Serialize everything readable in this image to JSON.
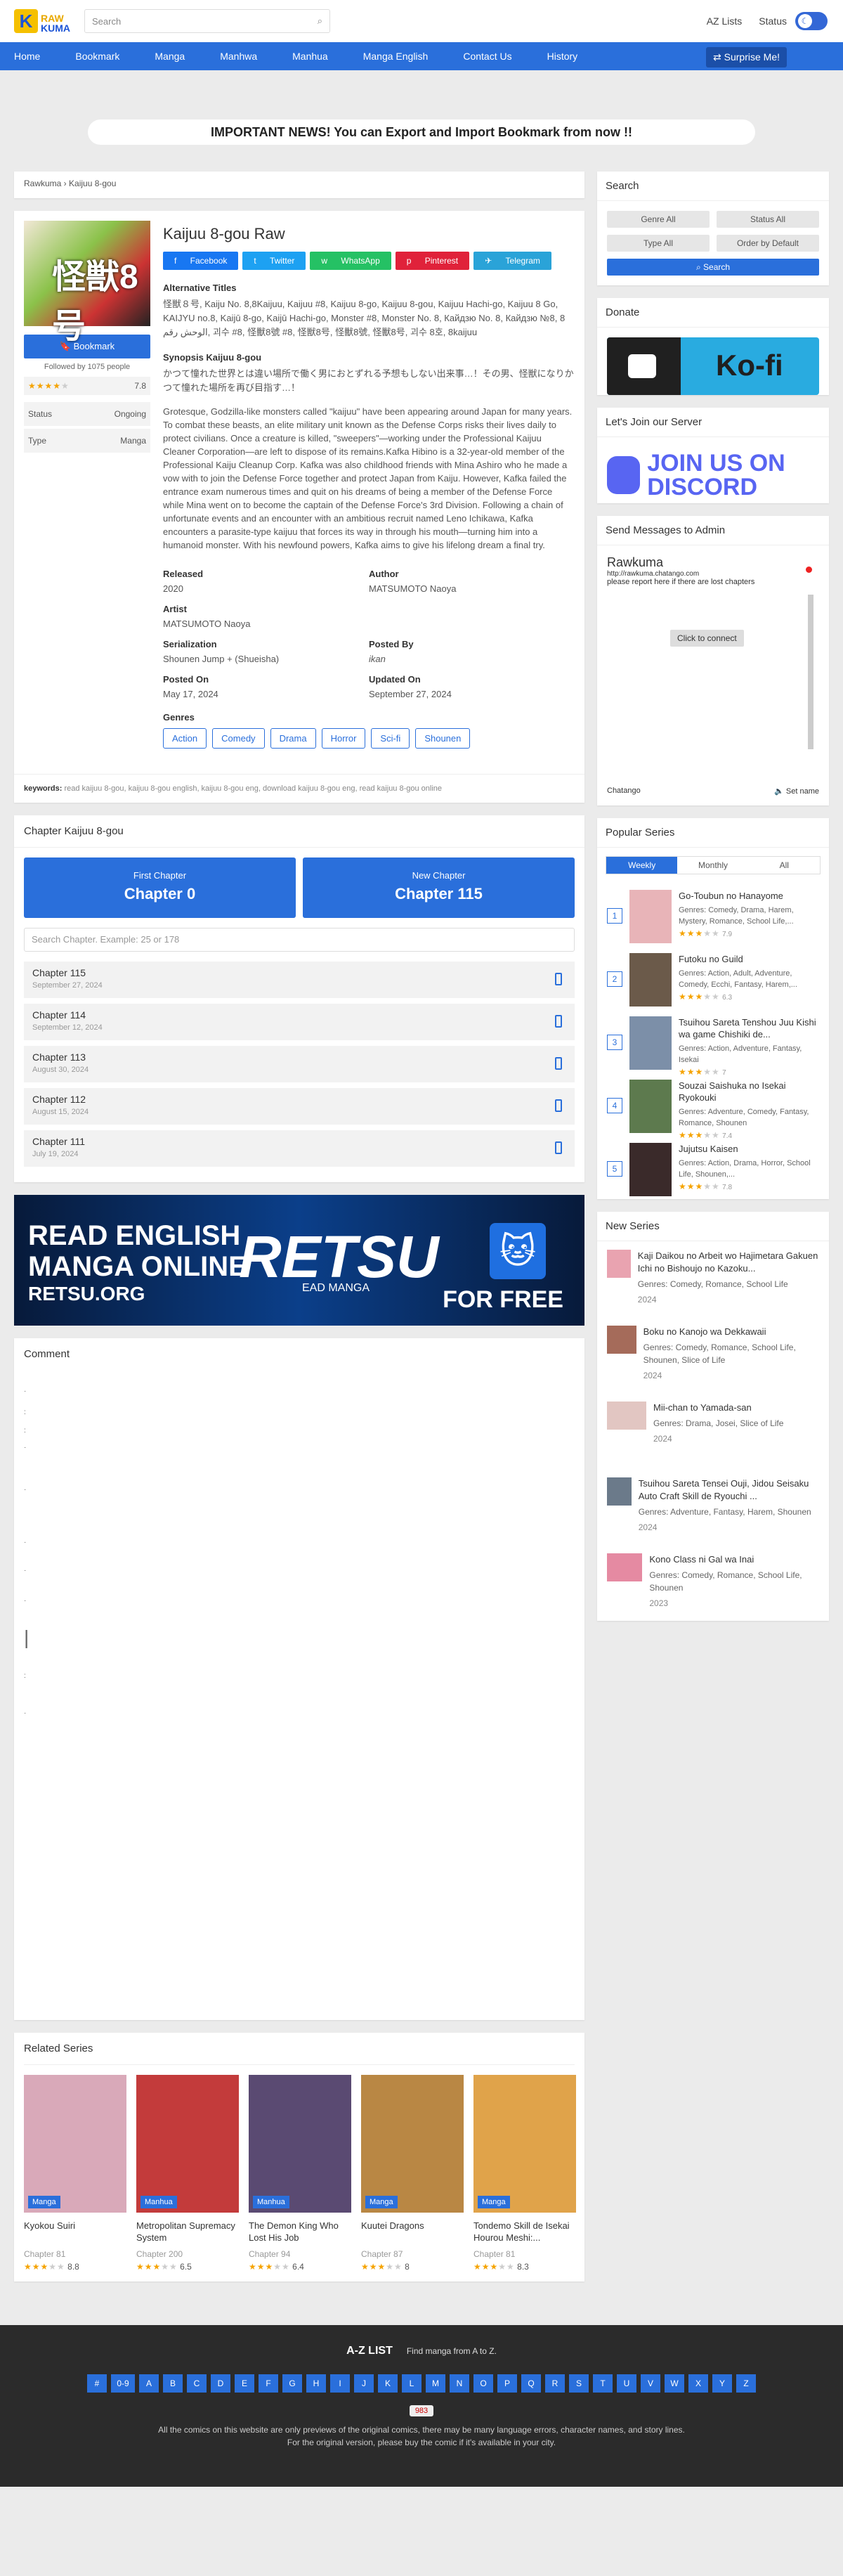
{
  "header": {
    "logo_top": "RAW",
    "logo_bottom": "KUMA",
    "search_placeholder": "Search",
    "links": [
      "AZ Lists",
      "Status"
    ]
  },
  "nav": {
    "items": [
      "Home",
      "Bookmark",
      "Manga",
      "Manhwa",
      "Manhua",
      "Manga English",
      "Contact Us",
      "History"
    ],
    "surprise": "Surprise Me!"
  },
  "news": "IMPORTANT NEWS! You can Export and Import Bookmark from now !!",
  "breadcrumb": "Rawkuma › Kaijuu 8-gou",
  "series": {
    "cover_text": "怪獣8号",
    "title": "Kaijuu 8-gou Raw",
    "bookmark": "Bookmark",
    "followed": "Followed by 1075 people",
    "rating": "7.8",
    "status_label": "Status",
    "status_value": "Ongoing",
    "type_label": "Type",
    "type_value": "Manga",
    "socials": [
      "Facebook",
      "Twitter",
      "WhatsApp",
      "Pinterest",
      "Telegram"
    ],
    "alt_label": "Alternative Titles",
    "alt_titles": "怪獣８号, Kaiju No. 8,8Kaijuu, Kaijuu #8, Kaijuu 8-go, Kaijuu 8-gou, Kaijuu Hachi-go, Kaijuu 8 Go, KAIJYU no.8, Kaijū 8-go, Kaijū Hachi-go, Monster #8, Monster No. 8, Кайдзю No. 8, Кайдзю №8, 8 الوحش رقم, 괴수 #8, 怪獸8號 #8, 怪獣8号, 怪獸8號, 怪獸8号, 괴수 8호, 8kaijuu",
    "synopsis_label": "Synopsis Kaijuu 8-gou",
    "synopsis_jp": "かつて憧れた世界とは違い場所で働く男におとずれる予想もしない出来事…！その男、怪獣になりかつて憧れた場所を再び目指す…！",
    "synopsis_en": "Grotesque, Godzilla-like monsters called \"kaijuu\" have been appearing around Japan for many years. To combat these beasts, an elite military unit known as the Defense Corps risks their lives daily to protect civilians. Once a creature is killed, \"sweepers\"—working under the Professional Kaijuu Cleaner Corporation—are left to dispose of its remains.Kafka Hibino is a 32-year-old member of the Professional Kaiju Cleanup Corp. Kafka was also childhood friends with Mina Ashiro who he made a vow with to join the Defense Force together and protect Japan from Kaiju. However, Kafka failed the entrance exam numerous times and quit on his dreams of being a member of the Defense Force while Mina went on to become the captain of the Defense Force's 3rd Division. Following a chain of unfortunate events and an encounter with an ambitious recruit named Leno Ichikawa, Kafka encounters a parasite-type kaijuu that forces its way in through his mouth—turning him into a humanoid monster. With his newfound powers, Kafka aims to give his lifelong dream a final try.",
    "meta": [
      {
        "k": "Released",
        "v": "2020"
      },
      {
        "k": "Author",
        "v": "MATSUMOTO Naoya"
      },
      {
        "k": "Artist",
        "v": "MATSUMOTO Naoya"
      },
      {
        "k": "",
        "v": ""
      },
      {
        "k": "Serialization",
        "v": "Shounen Jump + (Shueisha)"
      },
      {
        "k": "Posted By",
        "v": "ikan"
      },
      {
        "k": "Posted On",
        "v": "May 17, 2024"
      },
      {
        "k": "Updated On",
        "v": "September 27, 2024"
      }
    ],
    "genres_label": "Genres",
    "genres": [
      "Action",
      "Comedy",
      "Drama",
      "Horror",
      "Sci-fi",
      "Shounen"
    ],
    "keywords_label": "keywords:",
    "keywords": "read kaijuu 8-gou, kaijuu 8-gou english, kaijuu 8-gou eng, download kaijuu 8-gou eng, read kaijuu 8-gou online"
  },
  "chapters": {
    "title": "Chapter Kaijuu 8-gou",
    "first_label": "First Chapter",
    "first_value": "Chapter 0",
    "new_label": "New Chapter",
    "new_value": "Chapter 115",
    "search_placeholder": "Search Chapter. Example: 25 or 178",
    "list": [
      {
        "t": "Chapter 115",
        "d": "September 27, 2024"
      },
      {
        "t": "Chapter 114",
        "d": "September 12, 2024"
      },
      {
        "t": "Chapter 113",
        "d": "August 30, 2024"
      },
      {
        "t": "Chapter 112",
        "d": "August 15, 2024"
      },
      {
        "t": "Chapter 111",
        "d": "July 19, 2024"
      }
    ]
  },
  "banner": {
    "left1": "READ ENGLISH",
    "left2": "MANGA ONLINE",
    "left3": "RETSU.ORG",
    "brand": "RETSU",
    "sub": "EAD MANGA",
    "right": "FOR FREE"
  },
  "comment_title": "Comment",
  "related": {
    "title": "Related Series",
    "items": [
      {
        "t": "Kyokou Suiri",
        "c": "Chapter 81",
        "r": "8.8",
        "tag": "Manga",
        "color": "#d9a9b9"
      },
      {
        "t": "Metropolitan Supremacy System",
        "c": "Chapter 200",
        "r": "6.5",
        "tag": "Manhua",
        "color": "#c33b3b"
      },
      {
        "t": "The Demon King Who Lost His Job",
        "c": "Chapter 94",
        "r": "6.4",
        "tag": "Manhua",
        "color": "#5a4a72"
      },
      {
        "t": "Kuutei Dragons",
        "c": "Chapter 87",
        "r": "8",
        "tag": "Manga",
        "color": "#b98744"
      },
      {
        "t": "Tondemo Skill de Isekai Hourou Meshi:...",
        "c": "Chapter 81",
        "r": "8.3",
        "tag": "Manga",
        "color": "#e0a34a"
      }
    ]
  },
  "sidebar": {
    "search_title": "Search",
    "filters": [
      "Genre All",
      "Status All",
      "Type All",
      "Order by Default"
    ],
    "search_button": "Search",
    "donate_title": "Donate",
    "kofi": "Ko-fi",
    "server_title": "Let's Join our Server",
    "discord": "JOIN US ON DISCORD",
    "messages_title": "Send Messages to Admin",
    "chat_name": "Rawkuma",
    "chat_url": "http://rawkuma.chatango.com",
    "chat_msg": "please report here if there are lost chapters",
    "chat_connect": "Click to connect",
    "chat_brand": "Chatango",
    "chat_setname": "Set name",
    "popular_title": "Popular Series",
    "tabs": [
      "Weekly",
      "Monthly",
      "All"
    ],
    "popular": [
      {
        "n": "1",
        "t": "Go-Toubun no Hanayome",
        "g": "Comedy, Drama, Harem, Mystery, Romance, School Life,...",
        "r": "7.9"
      },
      {
        "n": "2",
        "t": "Futoku no Guild",
        "g": "Action, Adult, Adventure, Comedy, Ecchi, Fantasy, Harem,...",
        "r": "6.3"
      },
      {
        "n": "3",
        "t": "Tsuihou Sareta Tenshou Juu Kishi wa game Chishiki de...",
        "g": "Action, Adventure, Fantasy, Isekai",
        "r": "7"
      },
      {
        "n": "4",
        "t": "Souzai Saishuka no Isekai Ryokouki",
        "g": "Adventure, Comedy, Fantasy, Romance, Shounen",
        "r": "7.4"
      },
      {
        "n": "5",
        "t": "Jujutsu Kaisen",
        "g": "Action, Drama, Horror, School Life, Shounen,...",
        "r": "7.8"
      }
    ],
    "genres_prefix": "Genres:",
    "new_title": "New Series",
    "new_series": [
      {
        "t": "Kaji Daikou no Arbeit wo Hajimetara Gakuen Ichi no Bishoujo no Kazoku...",
        "g": "Comedy, Romance, School Life",
        "y": "2024"
      },
      {
        "t": "Boku no Kanojo wa Dekkawaii",
        "g": "Comedy, Romance, School Life, Shounen, Slice of Life",
        "y": "2024"
      },
      {
        "t": "Mii-chan to Yamada-san",
        "g": "Drama, Josei, Slice of Life",
        "y": "2024"
      },
      {
        "t": "Tsuihou Sareta Tensei Ouji, Jidou Seisaku Auto Craft Skill de Ryouchi ...",
        "g": "Adventure, Fantasy, Harem, Shounen",
        "y": "2024"
      },
      {
        "t": "Kono Class ni Gal wa Inai",
        "g": "Comedy, Romance, School Life, Shounen",
        "y": "2023"
      }
    ]
  },
  "footer": {
    "az": "A-Z LIST",
    "az_sub": "Find manga from A to Z.",
    "letters": [
      "#",
      "0-9",
      "A",
      "B",
      "C",
      "D",
      "E",
      "F",
      "G",
      "H",
      "I",
      "J",
      "K",
      "L",
      "M",
      "N",
      "O",
      "P",
      "Q",
      "R",
      "S",
      "T",
      "U",
      "V",
      "W",
      "X",
      "Y",
      "Z"
    ],
    "counter": "983",
    "disclaimer": "All the comics on this website are only previews of the original comics, there may be many language errors, character names, and story lines. For the original version, please buy the comic if it's available in your city."
  }
}
